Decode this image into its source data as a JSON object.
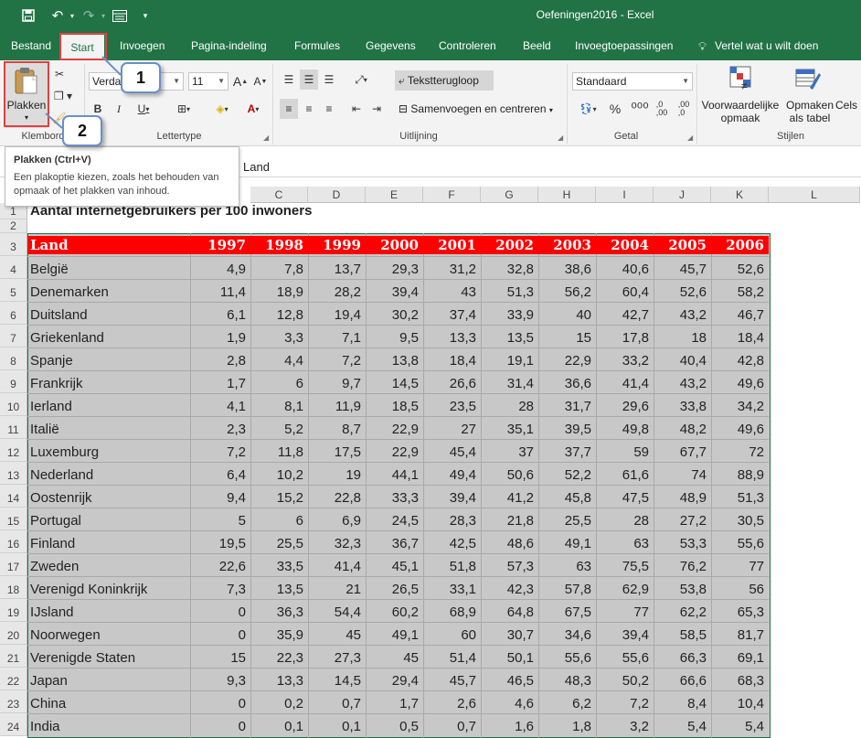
{
  "window": {
    "title": "Oefeningen2016 - Excel"
  },
  "tabs": [
    {
      "label": "Bestand"
    },
    {
      "label": "Start"
    },
    {
      "label": "Invoegen"
    },
    {
      "label": "Pagina-indeling"
    },
    {
      "label": "Formules"
    },
    {
      "label": "Gegevens"
    },
    {
      "label": "Controleren"
    },
    {
      "label": "Beeld"
    },
    {
      "label": "Invoegtoepassingen"
    },
    {
      "label": "Vertel wat u wilt doen"
    }
  ],
  "ribbon": {
    "paste_label": "Plakken",
    "font_name": "Verdana",
    "font_size": "11",
    "wrap_text": "Tekstterugloop",
    "merge_center": "Samenvoegen en centreren",
    "number_format": "Standaard",
    "conditional_format": "Voorwaardelijke opmaak",
    "format_as_table": "Opmaken als tabel",
    "cell_styles": "Cels",
    "groups": {
      "clipboard": "Klembord",
      "font": "Lettertype",
      "alignment": "Uitlijning",
      "number": "Getal",
      "styles": "Stijlen"
    }
  },
  "tooltip": {
    "title": "Plakken (Ctrl+V)",
    "description": "Een plakoptie kiezen, zoals het behouden van opmaak of het plakken van inhoud."
  },
  "formula_bar": {
    "content": "Land"
  },
  "callouts": [
    "1",
    "2"
  ],
  "sheet": {
    "columns": [
      "C",
      "D",
      "E",
      "F",
      "G",
      "H",
      "I",
      "J",
      "K",
      "L"
    ],
    "title": "Aantal internetgebruikers per 100 inwoners",
    "header": [
      "Land",
      "1997",
      "1998",
      "1999",
      "2000",
      "2001",
      "2002",
      "2003",
      "2004",
      "2005",
      "2006"
    ],
    "rows": [
      [
        "België",
        "4,9",
        "7,8",
        "13,7",
        "29,3",
        "31,2",
        "32,8",
        "38,6",
        "40,6",
        "45,7",
        "52,6"
      ],
      [
        "Denemarken",
        "11,4",
        "18,9",
        "28,2",
        "39,4",
        "43",
        "51,3",
        "56,2",
        "60,4",
        "52,6",
        "58,2"
      ],
      [
        "Duitsland",
        "6,1",
        "12,8",
        "19,4",
        "30,2",
        "37,4",
        "33,9",
        "40",
        "42,7",
        "43,2",
        "46,7"
      ],
      [
        "Griekenland",
        "1,9",
        "3,3",
        "7,1",
        "9,5",
        "13,3",
        "13,5",
        "15",
        "17,8",
        "18",
        "18,4"
      ],
      [
        "Spanje",
        "2,8",
        "4,4",
        "7,2",
        "13,8",
        "18,4",
        "19,1",
        "22,9",
        "33,2",
        "40,4",
        "42,8"
      ],
      [
        "Frankrijk",
        "1,7",
        "6",
        "9,7",
        "14,5",
        "26,6",
        "31,4",
        "36,6",
        "41,4",
        "43,2",
        "49,6"
      ],
      [
        "Ierland",
        "4,1",
        "8,1",
        "11,9",
        "18,5",
        "23,5",
        "28",
        "31,7",
        "29,6",
        "33,8",
        "34,2"
      ],
      [
        "Italië",
        "2,3",
        "5,2",
        "8,7",
        "22,9",
        "27",
        "35,1",
        "39,5",
        "49,8",
        "48,2",
        "49,6"
      ],
      [
        "Luxemburg",
        "7,2",
        "11,8",
        "17,5",
        "22,9",
        "45,4",
        "37",
        "37,7",
        "59",
        "67,7",
        "72"
      ],
      [
        "Nederland",
        "6,4",
        "10,2",
        "19",
        "44,1",
        "49,4",
        "50,6",
        "52,2",
        "61,6",
        "74",
        "88,9"
      ],
      [
        "Oostenrijk",
        "9,4",
        "15,2",
        "22,8",
        "33,3",
        "39,4",
        "41,2",
        "45,8",
        "47,5",
        "48,9",
        "51,3"
      ],
      [
        "Portugal",
        "5",
        "6",
        "6,9",
        "24,5",
        "28,3",
        "21,8",
        "25,5",
        "28",
        "27,2",
        "30,5"
      ],
      [
        "Finland",
        "19,5",
        "25,5",
        "32,3",
        "36,7",
        "42,5",
        "48,6",
        "49,1",
        "63",
        "53,3",
        "55,6"
      ],
      [
        "Zweden",
        "22,6",
        "33,5",
        "41,4",
        "45,1",
        "51,8",
        "57,3",
        "63",
        "75,5",
        "76,2",
        "77"
      ],
      [
        "Verenigd Koninkrijk",
        "7,3",
        "13,5",
        "21",
        "26,5",
        "33,1",
        "42,3",
        "57,8",
        "62,9",
        "53,8",
        "56"
      ],
      [
        "IJsland",
        "0",
        "36,3",
        "54,4",
        "60,2",
        "68,9",
        "64,8",
        "67,5",
        "77",
        "62,2",
        "65,3"
      ],
      [
        "Noorwegen",
        "0",
        "35,9",
        "45",
        "49,1",
        "60",
        "30,7",
        "34,6",
        "39,4",
        "58,5",
        "81,7"
      ],
      [
        "Verenigde Staten",
        "15",
        "22,3",
        "27,3",
        "45",
        "51,4",
        "50,1",
        "55,6",
        "55,6",
        "66,3",
        "69,1"
      ],
      [
        "Japan",
        "9,3",
        "13,3",
        "14,5",
        "29,4",
        "45,7",
        "46,5",
        "48,3",
        "50,2",
        "66,6",
        "68,3"
      ],
      [
        "China",
        "0",
        "0,2",
        "0,7",
        "1,7",
        "2,6",
        "4,6",
        "6,2",
        "7,2",
        "8,4",
        "10,4"
      ],
      [
        "India",
        "0",
        "0,1",
        "0,1",
        "0,5",
        "0,7",
        "1,6",
        "1,8",
        "3,2",
        "5,4",
        "5,4"
      ]
    ],
    "row_numbers": [
      "1",
      "2",
      "3",
      "4",
      "5",
      "6",
      "7",
      "8",
      "9",
      "10",
      "11",
      "12",
      "13",
      "14",
      "15",
      "16",
      "17",
      "18",
      "19",
      "20",
      "21",
      "22",
      "23",
      "24"
    ]
  },
  "colors": {
    "excel_green": "#217346",
    "header_red": "#ff0000",
    "data_fill": "#c8c8c8",
    "callout_border": "#6b8fc7",
    "highlight_red": "#e04040"
  }
}
